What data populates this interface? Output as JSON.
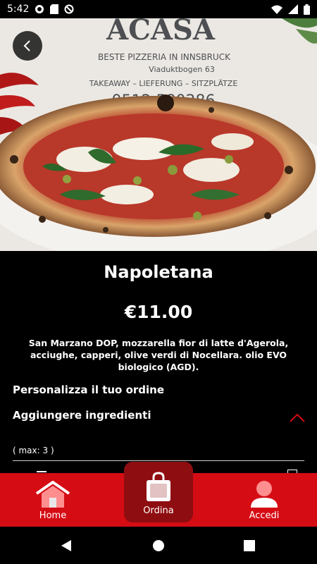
{
  "status_bar": {
    "time": "5:42",
    "left_icons": [
      "gear-icon",
      "sd-card-icon",
      "do-not-disturb-icon"
    ],
    "right_icons": [
      "wifi-icon",
      "signal-icon",
      "battery-icon"
    ]
  },
  "hero": {
    "image_label": "pizza-photo",
    "sign_lines": [
      "ACASA",
      "BESTE PIZZERIA IN INNSBRUCK",
      "Viaduktbogen 63",
      "TAKEAWAY – LIEFERUNG – SITZPLÄTZE",
      "0512 580286"
    ]
  },
  "product": {
    "name": "Napoletana",
    "price": "€11.00",
    "description": "San Marzano DOP, mozzarella fior di latte d'Agerola, acciughe, capperi, olive verdi di Nocellara. olio EVO biologico (AGD)."
  },
  "options": {
    "personalize_label": "Personalizza il tuo ordine",
    "add_ingredients_label": "Aggiungere ingredienti",
    "max_label": "( max: 3 )"
  },
  "bottom_nav": {
    "home_label": "Home",
    "ordina_label": "Ordina",
    "accedi_label": "Accedi"
  },
  "colors": {
    "brand_red": "#d50c14",
    "ordina_active": "#8e0d10",
    "chevron_red": "#d50c14"
  }
}
